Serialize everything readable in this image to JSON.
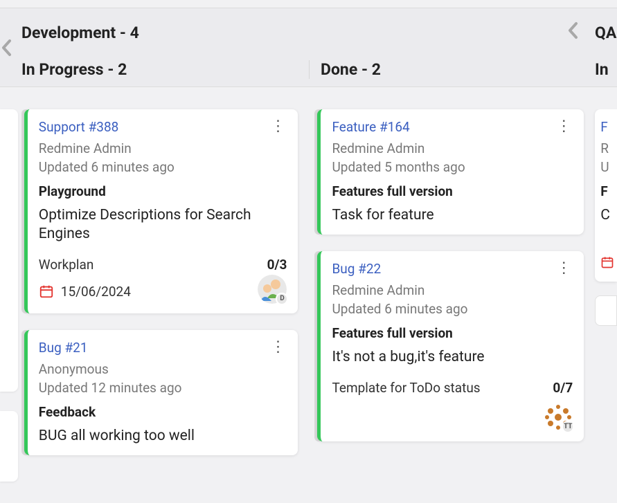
{
  "columns": {
    "dev": {
      "title": "Development - 4"
    },
    "inprogress": {
      "title": "In Progress - 2"
    },
    "done": {
      "title": "Done - 2"
    },
    "qa": {
      "title": "QA",
      "sub": "In"
    }
  },
  "cards": {
    "c388": {
      "tracker": "Support",
      "id": "#388",
      "author": "Redmine Admin",
      "updated": "Updated 6 minutes ago",
      "version": "Playground",
      "subject": "Optimize Descriptions for Search Engines",
      "checklist_name": "Workplan",
      "checklist_count": "0/3",
      "due": "15/06/2024",
      "avatar_badge": "D"
    },
    "c21": {
      "tracker": "Bug",
      "id": "#21",
      "author": "Anonymous",
      "updated": "Updated 12 minutes ago",
      "version": "Feedback",
      "subject": "BUG all working too well"
    },
    "c164": {
      "tracker": "Feature",
      "id": "#164",
      "author": "Redmine Admin",
      "updated": "Updated 5 months ago",
      "version": "Features full version",
      "subject": "Task for feature"
    },
    "c22": {
      "tracker": "Bug",
      "id": "#22",
      "author": "Redmine Admin",
      "updated": "Updated 6 minutes ago",
      "version": "Features full version",
      "subject": "It's not a bug,it's feature",
      "checklist_name": "Template for ToDo status",
      "checklist_count": "0/7",
      "avatar_badge": "TT"
    },
    "qa1": {
      "tracker": "F",
      "author": "R",
      "updated": "U",
      "version": "F",
      "subject": "C"
    }
  }
}
